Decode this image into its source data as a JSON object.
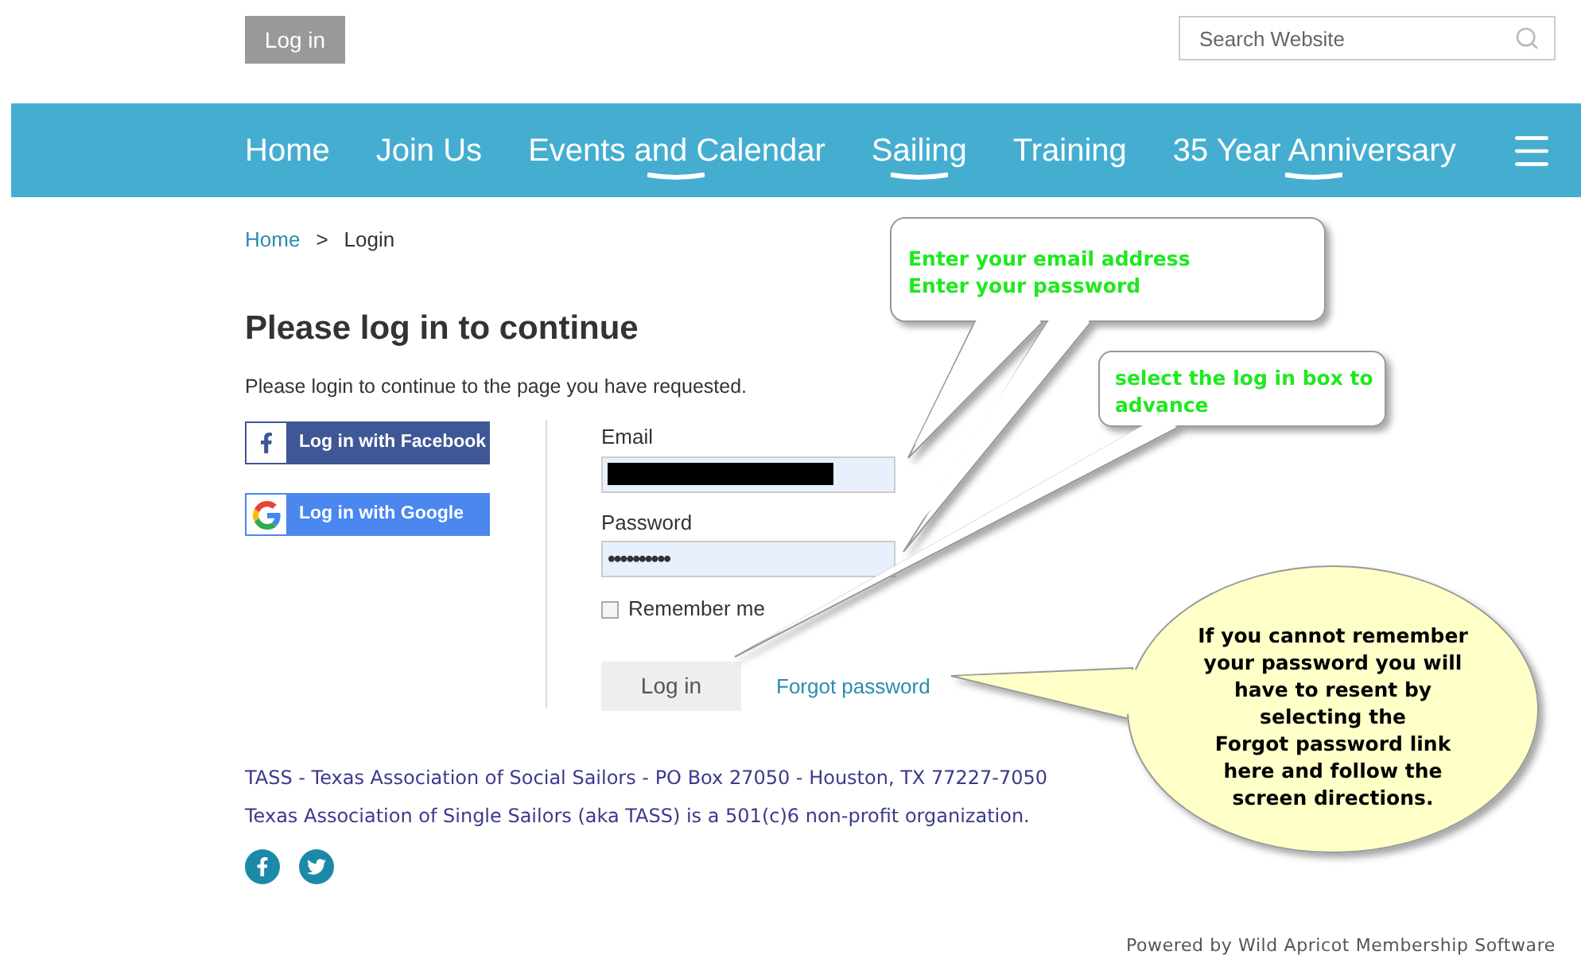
{
  "header": {
    "login_button": "Log in",
    "search": {
      "placeholder": "Search Website"
    }
  },
  "nav": {
    "items": [
      {
        "label": "Home",
        "has_submenu": false
      },
      {
        "label": "Join Us",
        "has_submenu": false
      },
      {
        "label": "Events and Calendar",
        "has_submenu": true
      },
      {
        "label": "Sailing",
        "has_submenu": true
      },
      {
        "label": "Training",
        "has_submenu": false
      },
      {
        "label": "35 Year Anniversary",
        "has_submenu": true
      }
    ]
  },
  "breadcrumb": [
    {
      "label": "Home",
      "kind": "link"
    },
    {
      "label": ">",
      "kind": "separator"
    },
    {
      "label": "Login",
      "kind": "current"
    }
  ],
  "heading": "Please log in to continue",
  "intro": "Please login to continue to the page you have requested.",
  "social_logins": [
    {
      "label": "Log in with Facebook",
      "kind": "facebook"
    },
    {
      "label": "Log in with Google",
      "kind": "google"
    }
  ],
  "form": {
    "email": {
      "label": "Email",
      "redacted": true
    },
    "password": {
      "label": "Password",
      "value": "••••••••••"
    },
    "remember": {
      "label": "Remember me",
      "checked": false
    },
    "submit": "Log in",
    "forgot_link": "Forgot password"
  },
  "footer": {
    "lines": [
      "TASS - Texas Association of Social Sailors - PO Box 27050 - Houston, TX 77227-7050",
      "Texas Association of Single Sailors (aka TASS) is a 501(c)6 non-profit organization."
    ],
    "social": [
      {
        "kind": "facebook"
      },
      {
        "kind": "twitter"
      }
    ],
    "powered_by": "Powered by Wild Apricot Membership Software"
  },
  "callouts": [
    {
      "kind": "box",
      "text": "Enter your email address\nEnter your password"
    },
    {
      "kind": "box",
      "text": "select the log in box to advance"
    },
    {
      "kind": "ellipse",
      "text": "If you cannot remember\nyour password you will\nhave to resent by\nselecting the\nForgot password link\nhere and follow the\nscreen directions."
    }
  ]
}
